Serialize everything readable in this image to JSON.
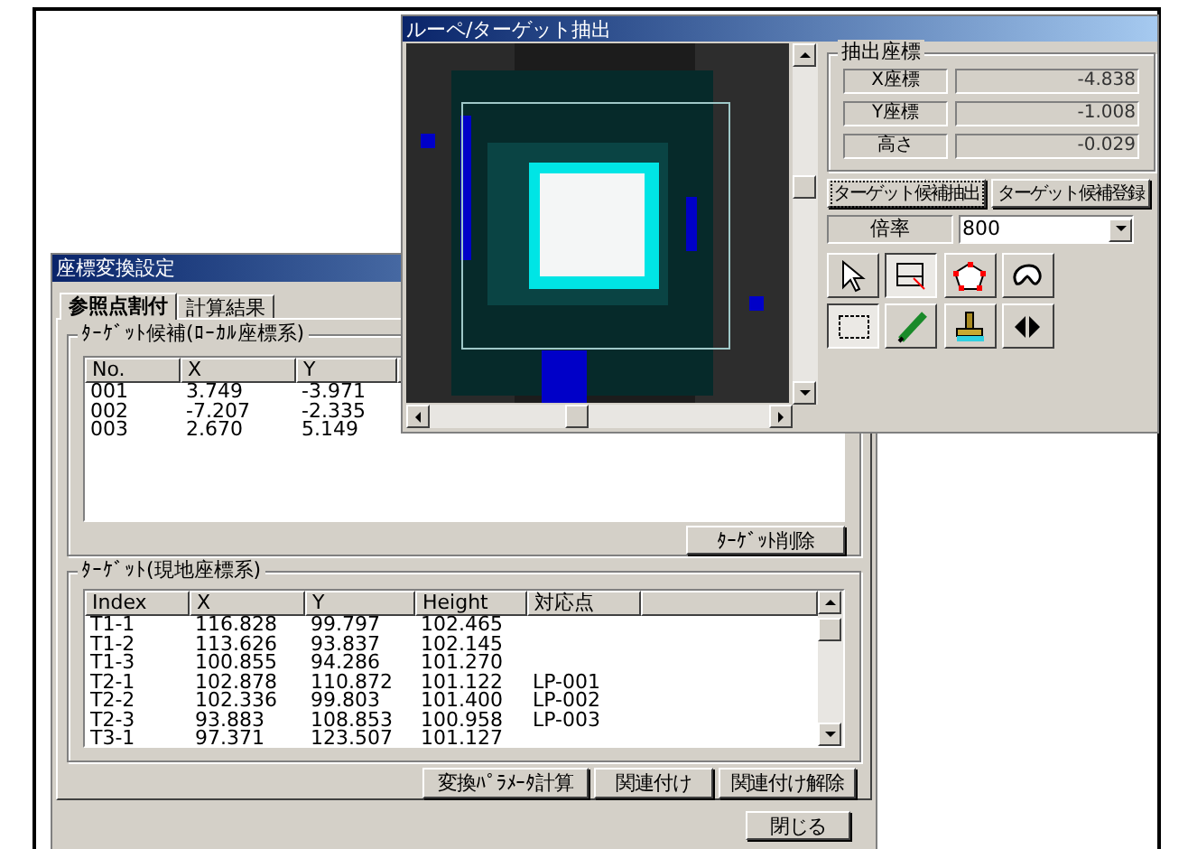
{
  "back_window": {
    "title": "座標変換設定",
    "tabs": [
      {
        "label": "参照点割付",
        "selected": true
      },
      {
        "label": "計算結果",
        "selected": false
      }
    ],
    "candidates": {
      "title": "ﾀｰｹﾞｯﾄ候補(ﾛｰｶﾙ座標系)",
      "columns": [
        "No.",
        "X",
        "Y"
      ],
      "rows": [
        [
          "001",
          "3.749",
          "-3.971"
        ],
        [
          "002",
          "-7.207",
          "-2.335"
        ],
        [
          "003",
          "2.670",
          "5.149"
        ]
      ],
      "delete_button": "ﾀｰｹﾞｯﾄ削除"
    },
    "targets": {
      "title": "ﾀｰｹﾞｯﾄ(現地座標系)",
      "columns": [
        "Index",
        "X",
        "Y",
        "Height",
        "対応点"
      ],
      "rows": [
        [
          "T1-1",
          "116.828",
          "99.797",
          "102.465",
          ""
        ],
        [
          "T1-2",
          "113.626",
          "93.837",
          "102.145",
          ""
        ],
        [
          "T1-3",
          "100.855",
          "94.286",
          "101.270",
          ""
        ],
        [
          "T2-1",
          "102.878",
          "110.872",
          "101.122",
          "LP-001"
        ],
        [
          "T2-2",
          "102.336",
          "99.803",
          "101.400",
          "LP-002"
        ],
        [
          "T2-3",
          "93.883",
          "108.853",
          "100.958",
          "LP-003"
        ],
        [
          "T3-1",
          "97.371",
          "123.507",
          "101.127",
          ""
        ]
      ]
    },
    "buttons": [
      "変換ﾊﾟﾗﾒｰﾀ計算",
      "関連付け",
      "関連付け解除"
    ],
    "close_button": "閉じる"
  },
  "front_window": {
    "title": "ルーペ/ターゲット抽出",
    "coords": {
      "title": "抽出座標",
      "rows": [
        {
          "label": "X座標",
          "value": "-4.838"
        },
        {
          "label": "Y座標",
          "value": "-1.008"
        },
        {
          "label": "高さ",
          "value": "-0.029"
        }
      ]
    },
    "buttons": [
      {
        "label": "ターゲット候補抽出",
        "focused": true
      },
      {
        "label": "ターゲット候補登録",
        "focused": false
      }
    ],
    "zoom": {
      "label": "倍率",
      "value": "800"
    },
    "tools": [
      {
        "kind": "pointer",
        "selected": false
      },
      {
        "kind": "rect-select",
        "selected": true
      },
      {
        "kind": "polygon",
        "selected": false
      },
      {
        "kind": "lasso",
        "selected": false
      },
      {
        "kind": "marquee",
        "selected": true
      },
      {
        "kind": "pen",
        "selected": false
      },
      {
        "kind": "stamp",
        "selected": false
      },
      {
        "kind": "flip",
        "selected": false
      }
    ]
  }
}
